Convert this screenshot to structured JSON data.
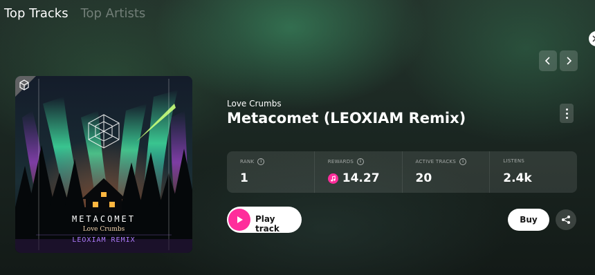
{
  "tabs": [
    {
      "label": "Top Tracks",
      "active": true
    },
    {
      "label": "Top Artists",
      "active": false
    }
  ],
  "nav": {
    "prev_icon": "chevron-left-icon",
    "next_icon": "chevron-right-icon"
  },
  "edge_button_icon": "chevron-right-icon",
  "cover": {
    "title_text": "METACOMET",
    "subtitle_text": "Love Crumbs",
    "remix_text": "LEOXIAM REMIX",
    "badge_icon": "cube-icon"
  },
  "track": {
    "artist": "Love Crumbs",
    "title": "Metacomet (LEOXIAM Remix)"
  },
  "stats": [
    {
      "label": "RANK",
      "value": "1"
    },
    {
      "label": "REWARDS",
      "value": "14.27",
      "icon": "music-note-icon"
    },
    {
      "label": "ACTIVE TRACKS",
      "value": "20"
    },
    {
      "label": "LISTENS",
      "value": "2.4k"
    }
  ],
  "actions": {
    "play_label": "Play track",
    "buy_label": "Buy",
    "share_icon": "share-icon",
    "more_icon": "more-vertical-icon"
  },
  "colors": {
    "accent": "#ff2d9b",
    "aurora": "#3fe0a0"
  }
}
